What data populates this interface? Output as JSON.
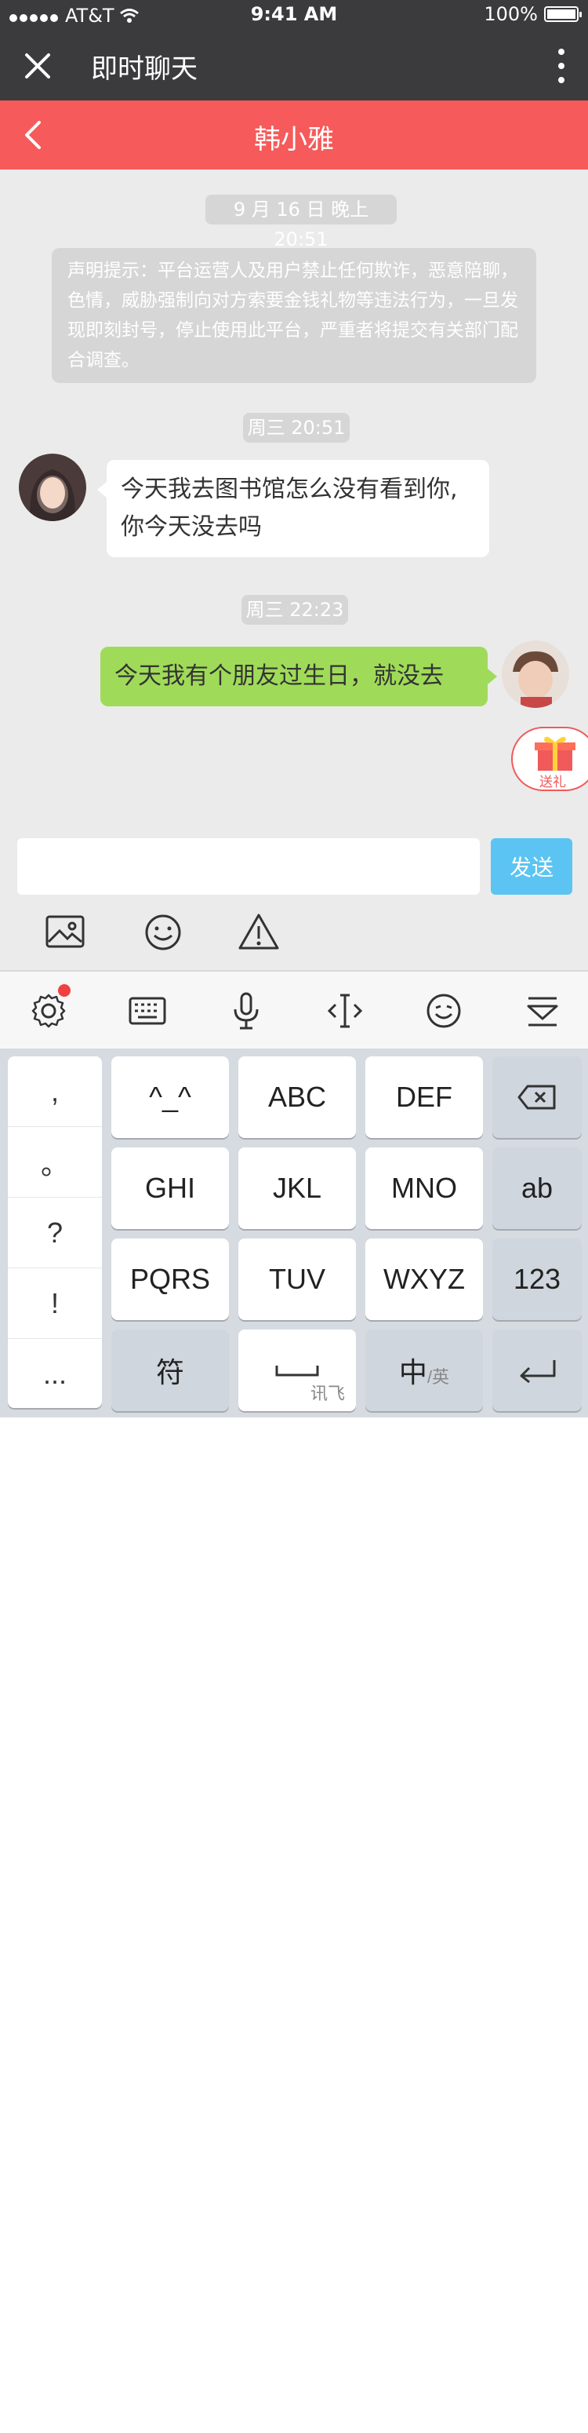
{
  "status_bar": {
    "carrier": "AT&T",
    "time": "9:41 AM",
    "battery": "100%"
  },
  "app_bar": {
    "title": "即时聊天"
  },
  "chat_header": {
    "contact_name": "韩小雅"
  },
  "messages": {
    "date_1": "9 月 16 日 晚上 20:51",
    "notice": "声明提示：平台运营人及用户禁止任何欺诈，恶意陪聊，色情，威胁强制向对方索要金钱礼物等违法行为，一旦发现即刻封号，停止使用此平台，严重者将提交有关部门配合调查。",
    "time_2": "周三 20:51",
    "incoming_1": "今天我去图书馆怎么没有看到你,你今天没去吗",
    "time_3": "周三 22:23",
    "outgoing_1": "今天我有个朋友过生日，就没去"
  },
  "gift": {
    "label": "送礼"
  },
  "composer": {
    "input_value": "",
    "send_label": "发送"
  },
  "keyboard": {
    "punctuation": [
      ",",
      "。",
      "?",
      "!",
      "..."
    ],
    "row1": [
      "^_^",
      "ABC",
      "DEF"
    ],
    "row2": [
      "GHI",
      "JKL",
      "MNO",
      "ab"
    ],
    "row3": [
      "PQRS",
      "TUV",
      "WXYZ",
      "123"
    ],
    "symbols_label": "符",
    "space_sublabel": "讯飞",
    "lang_label": "中",
    "lang_sub": "/英"
  },
  "colors": {
    "header_red": "#f65a5a",
    "send_blue": "#5bc4f2",
    "bubble_green": "#9fdb58",
    "dark_bar": "#3b3b3d"
  }
}
